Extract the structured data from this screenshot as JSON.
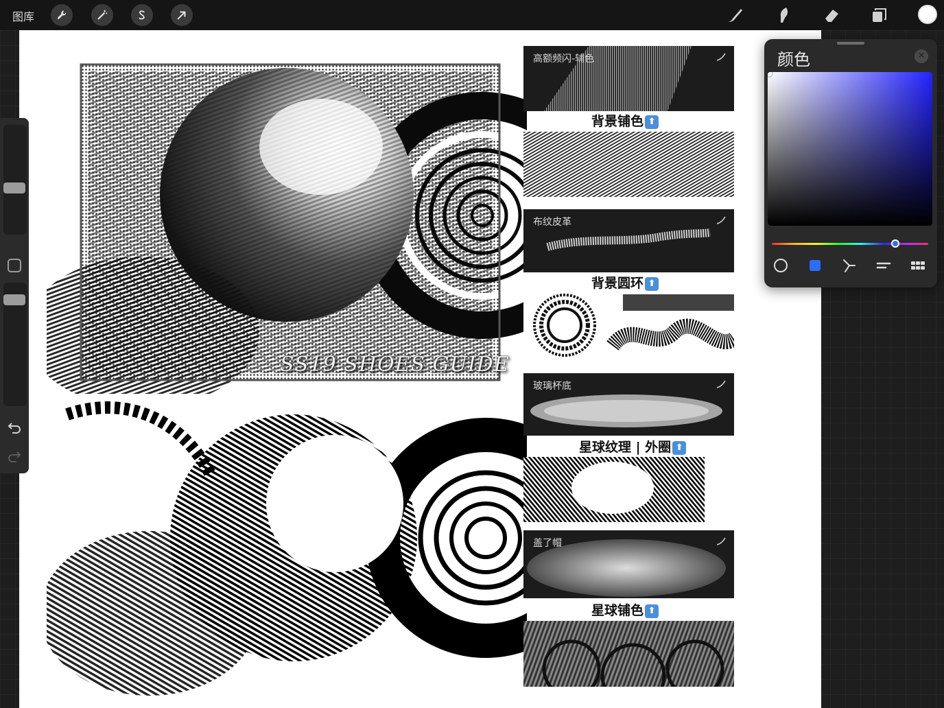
{
  "toolbar": {
    "gallery_label": "图库",
    "left_tools": [
      "wrench-icon",
      "magic-wand-icon",
      "selection-icon",
      "transform-arrow-icon"
    ],
    "right_tools": [
      "brush-icon",
      "smudge-icon",
      "eraser-icon",
      "layers-icon"
    ],
    "current_color": "#ffffff"
  },
  "sidebar": {
    "size_slider_value": 0.2,
    "opacity_slider_value": 0.35,
    "undo_icon": "undo-icon",
    "redo_icon": "redo-icon"
  },
  "artwork": {
    "title_text": "SS19 SHOES GUIDE"
  },
  "brushes": [
    {
      "name": "高额频闪-辅色",
      "caption": "背景铺色"
    },
    {
      "name": "布纹皮革",
      "caption": "背景圆环"
    },
    {
      "name": "玻璃杯底",
      "caption": "星球纹理 | 外圈"
    },
    {
      "name": "盖了帽",
      "caption": "星球铺色"
    }
  ],
  "color_panel": {
    "title": "颜色",
    "hue": "#2323ff",
    "accent": "#2d6cff",
    "modes": [
      "disc-mode-icon",
      "classic-mode-icon",
      "harmony-mode-icon",
      "value-mode-icon",
      "palettes-mode-icon"
    ],
    "active_mode": "classic-mode-icon"
  }
}
